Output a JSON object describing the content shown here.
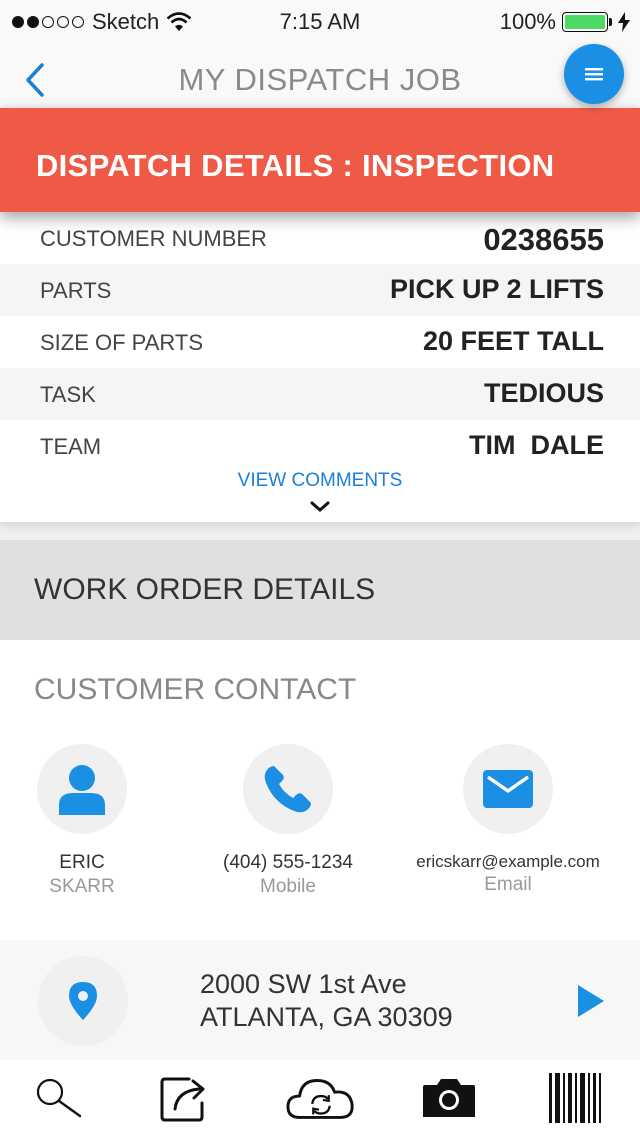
{
  "status_bar": {
    "carrier": "Sketch",
    "time": "7:15 AM",
    "battery": "100%"
  },
  "nav": {
    "title": "MY DISPATCH JOB"
  },
  "dispatch": {
    "header": "DISPATCH DETAILS : INSPECTION",
    "rows": [
      {
        "label": "CUSTOMER NUMBER",
        "value": "0238655"
      },
      {
        "label": "PARTS",
        "value": "PICK UP 2 LIFTS"
      },
      {
        "label": "SIZE OF PARTS",
        "value": "20 FEET TALL"
      },
      {
        "label": "TASK",
        "value": "TEDIOUS"
      },
      {
        "label": "TEAM",
        "value": "TIM  DALE"
      }
    ],
    "view_comments": "VIEW COMMENTS"
  },
  "work_order": {
    "title": "WORK ORDER DETAILS"
  },
  "contact": {
    "title": "CUSTOMER CONTACT",
    "person": {
      "first": "ERIC",
      "last": "SKARR"
    },
    "phone": {
      "number": "(404) 555-1234",
      "type": "Mobile"
    },
    "email": {
      "address": "ericskarr@example.com",
      "type": "Email"
    }
  },
  "address": {
    "line1": "2000 SW 1st Ave",
    "line2": "ATLANTA, GA 30309"
  },
  "tab_bar": {
    "icons": [
      "search-icon",
      "share-icon",
      "cloud-sync-icon",
      "camera-icon",
      "barcode-icon"
    ]
  },
  "colors": {
    "accent_red": "#ee5a45",
    "accent_blue": "#1a8fe3",
    "icon_blue": "#1a8fe3"
  }
}
